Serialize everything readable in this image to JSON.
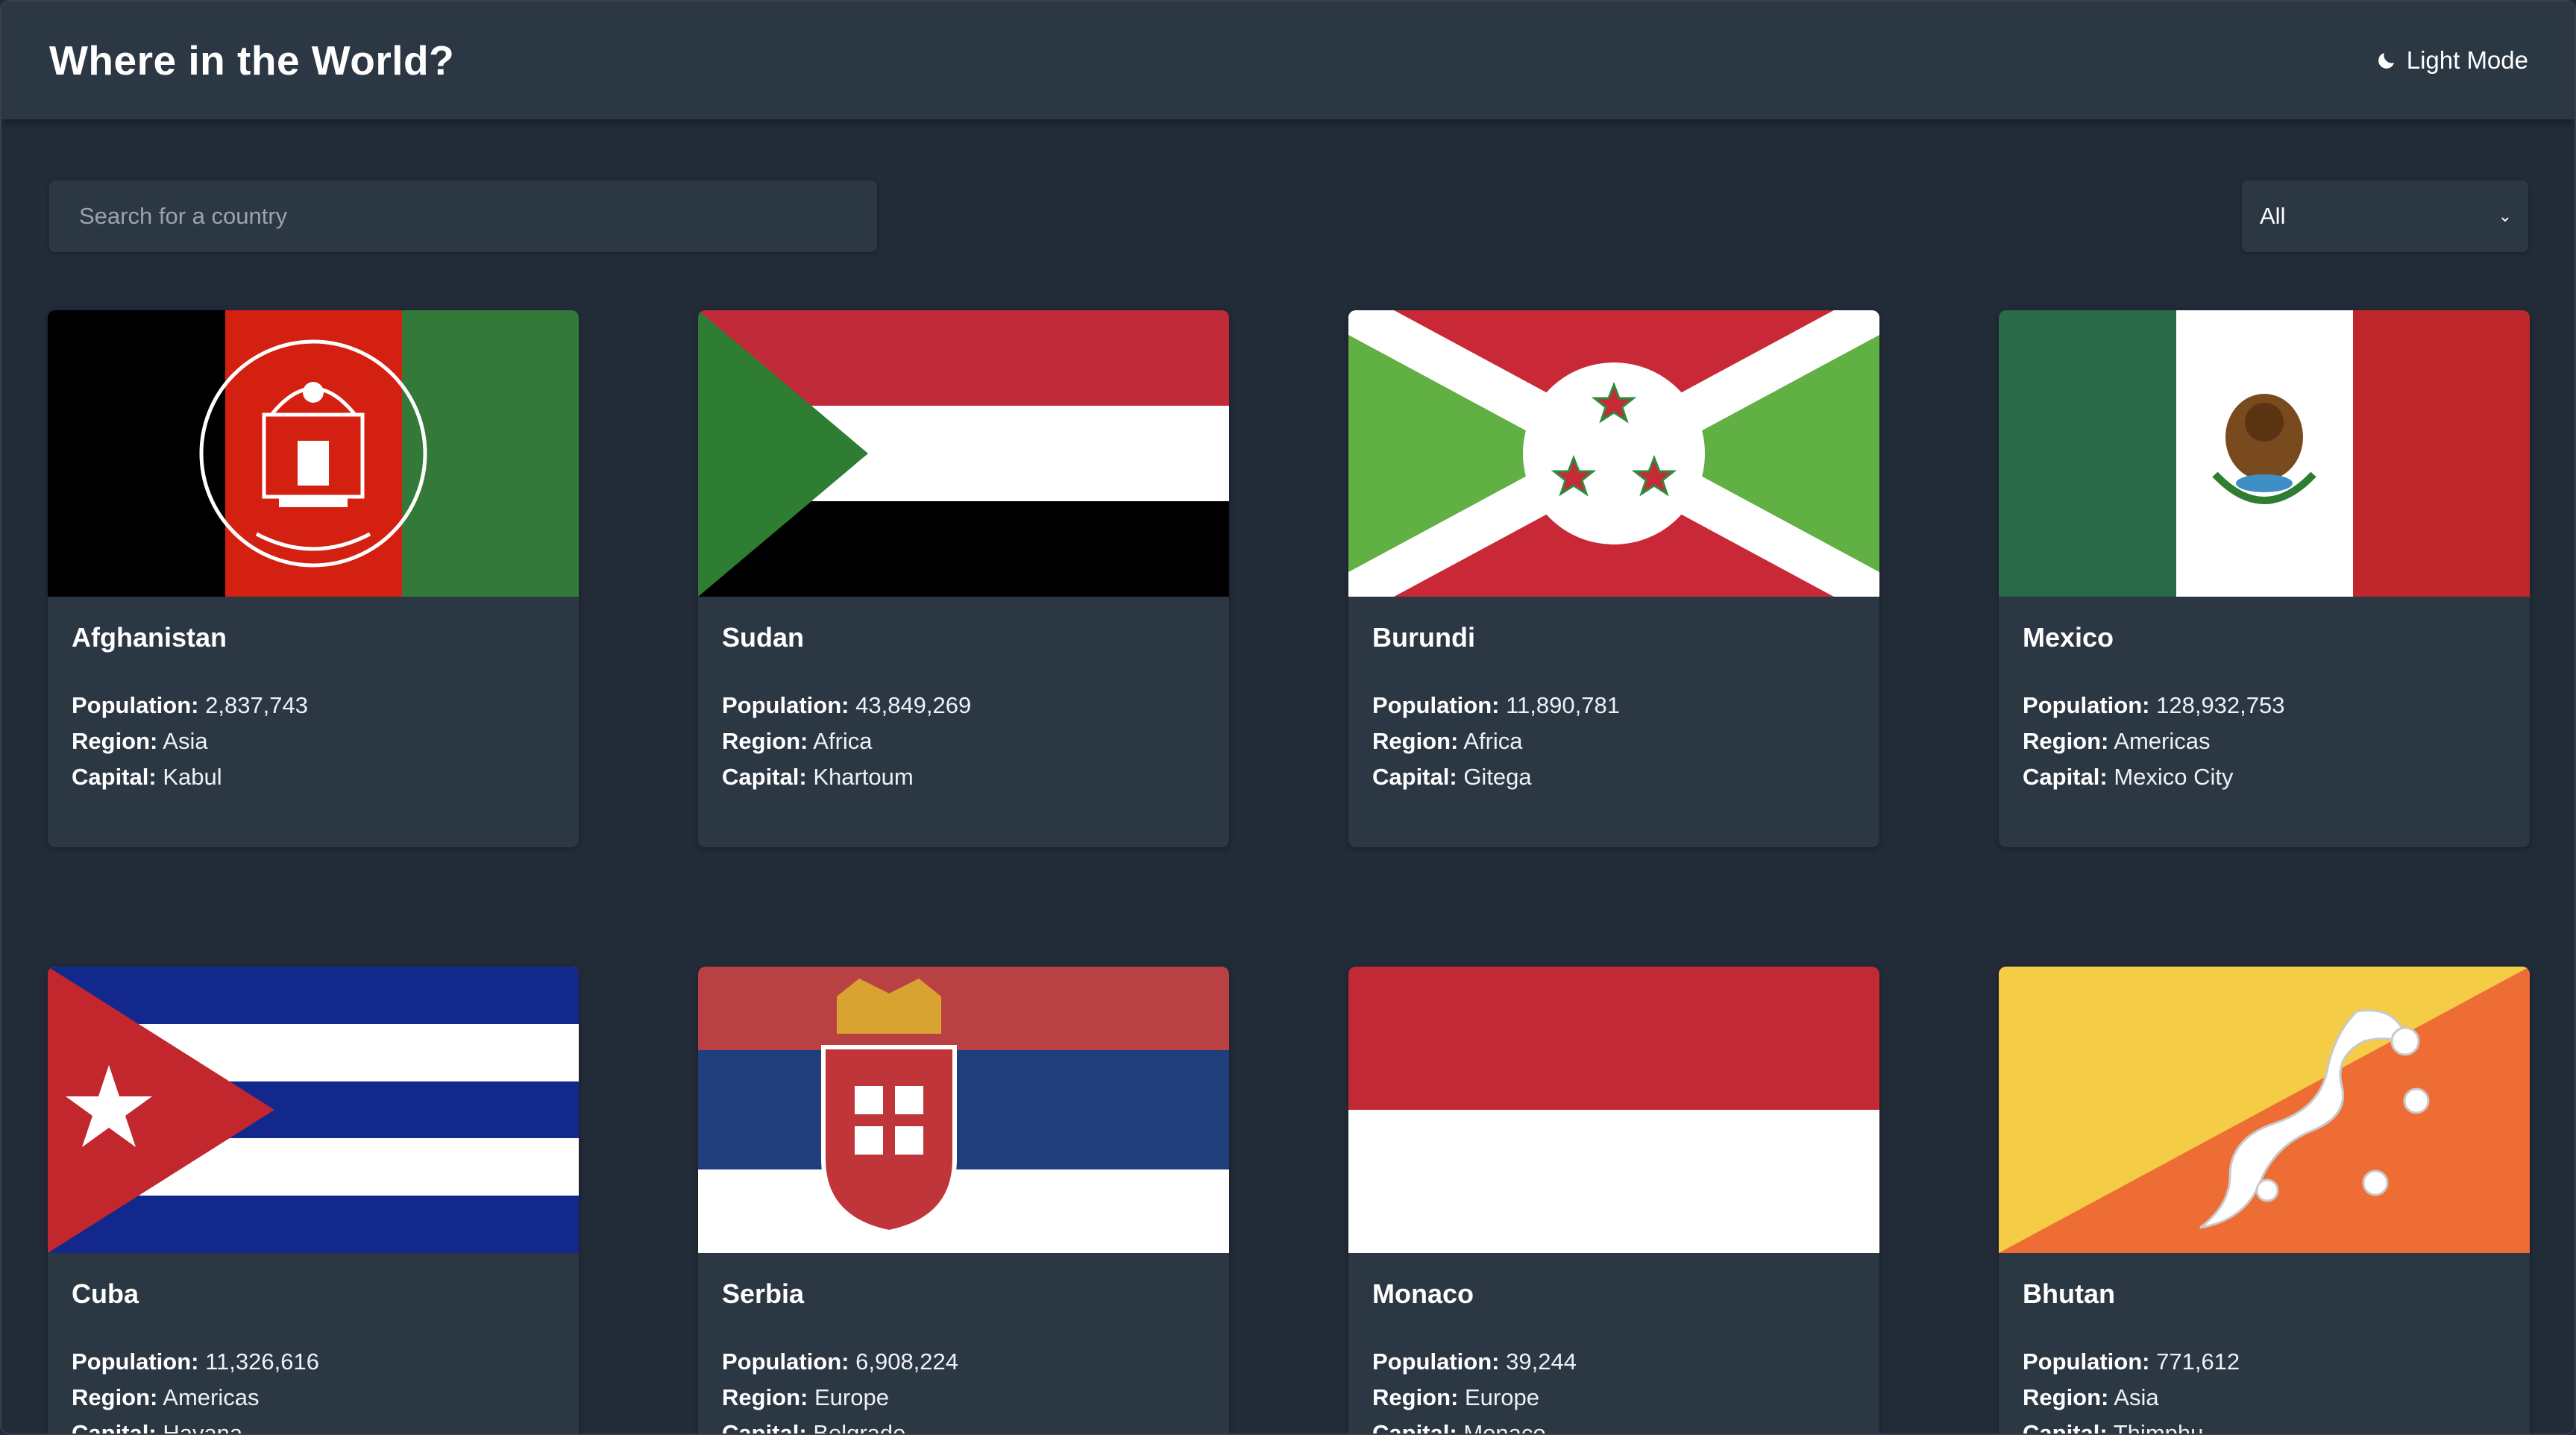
{
  "header": {
    "title": "Where in the World?",
    "mode_toggle_label": "Light Mode",
    "mode_icon": "moon-icon"
  },
  "search": {
    "placeholder": "Search for a country",
    "value": ""
  },
  "filter": {
    "selected": "All",
    "icon": "chevron-down-icon"
  },
  "labels": {
    "population": "Population:",
    "region": "Region:",
    "capital": "Capital:"
  },
  "countries": [
    {
      "name": "Afghanistan",
      "population": "2,837,743",
      "region": "Asia",
      "capital": "Kabul"
    },
    {
      "name": "Sudan",
      "population": "43,849,269",
      "region": "Africa",
      "capital": "Khartoum"
    },
    {
      "name": "Burundi",
      "population": "11,890,781",
      "region": "Africa",
      "capital": "Gitega"
    },
    {
      "name": "Mexico",
      "population": "128,932,753",
      "region": "Americas",
      "capital": "Mexico City"
    },
    {
      "name": "Cuba",
      "population": "11,326,616",
      "region": "Americas",
      "capital": "Havana"
    },
    {
      "name": "Serbia",
      "population": "6,908,224",
      "region": "Europe",
      "capital": "Belgrade"
    },
    {
      "name": "Monaco",
      "population": "39,244",
      "region": "Europe",
      "capital": "Monaco"
    },
    {
      "name": "Bhutan",
      "population": "771,612",
      "region": "Asia",
      "capital": "Thimphu"
    }
  ],
  "colors": {
    "background": "#222b38",
    "element": "#2c3744",
    "text": "#ffffff",
    "placeholder": "#9aa3ad"
  }
}
